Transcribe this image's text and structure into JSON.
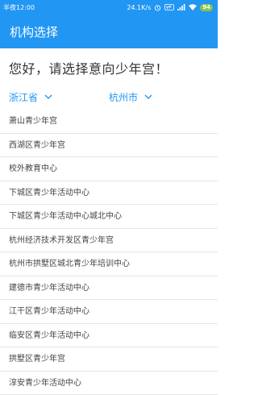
{
  "status_bar": {
    "time": "半夜12:00",
    "speed": "24.1K/s",
    "battery": "94",
    "colors": {
      "background": "#2196f3",
      "battery": "#8bc34a"
    }
  },
  "app_bar": {
    "title": "机构选择"
  },
  "greeting": "您好，请选择意向少年宫！",
  "province_selector": {
    "label": "浙江省",
    "icon": "chevron-down-icon"
  },
  "city_selector": {
    "label": "杭州市",
    "icon": "chevron-down-icon"
  },
  "institutions": [
    "萧山青少年宫",
    "西湖区青少年宫",
    "校外教育中心",
    "下城区青少年活动中心",
    "下城区青少年活动中心城北中心",
    "杭州经济技术开发区青少年宫",
    "杭州市拱墅区城北青少年培训中心",
    "建德市青少年活动中心",
    "江干区青少年活动中心",
    "临安区青少年活动中心",
    "拱墅区青少年宫",
    "淳安青少年活动中心"
  ],
  "accent_color": "#2196f3"
}
